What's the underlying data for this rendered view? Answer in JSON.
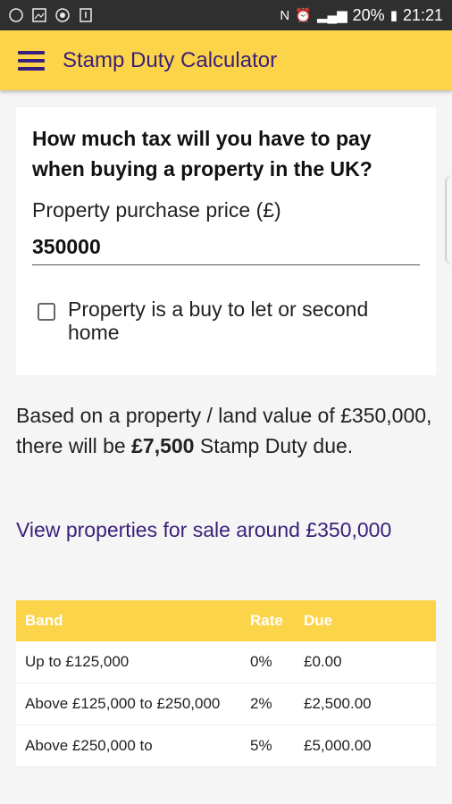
{
  "status_bar": {
    "battery": "20%",
    "time": "21:21",
    "network_label": "N"
  },
  "app_bar": {
    "title": "Stamp Duty Calculator"
  },
  "calculator": {
    "question": "How much tax will you have to pay when buying a property in the UK?",
    "price_label": "Property purchase price (£)",
    "price_value": "350000",
    "checkbox_label": "Property is a buy to let or second home",
    "checkbox_checked": false
  },
  "result": {
    "text_before": "Based on a property / land value of £350,000, there will be ",
    "amount": "£7,500",
    "text_after": " Stamp Duty due."
  },
  "link": {
    "label": "View properties for sale around £350,000"
  },
  "table": {
    "headers": {
      "band": "Band",
      "rate": "Rate",
      "due": "Due"
    },
    "rows": [
      {
        "band": "Up to £125,000",
        "rate": "0%",
        "due": "£0.00"
      },
      {
        "band": "Above £125,000 to £250,000",
        "rate": "2%",
        "due": "£2,500.00"
      },
      {
        "band": "Above £250,000 to",
        "rate": "5%",
        "due": "£5,000.00"
      }
    ]
  },
  "colors": {
    "accent": "#fcd44a",
    "brand": "#3a1f7a"
  }
}
